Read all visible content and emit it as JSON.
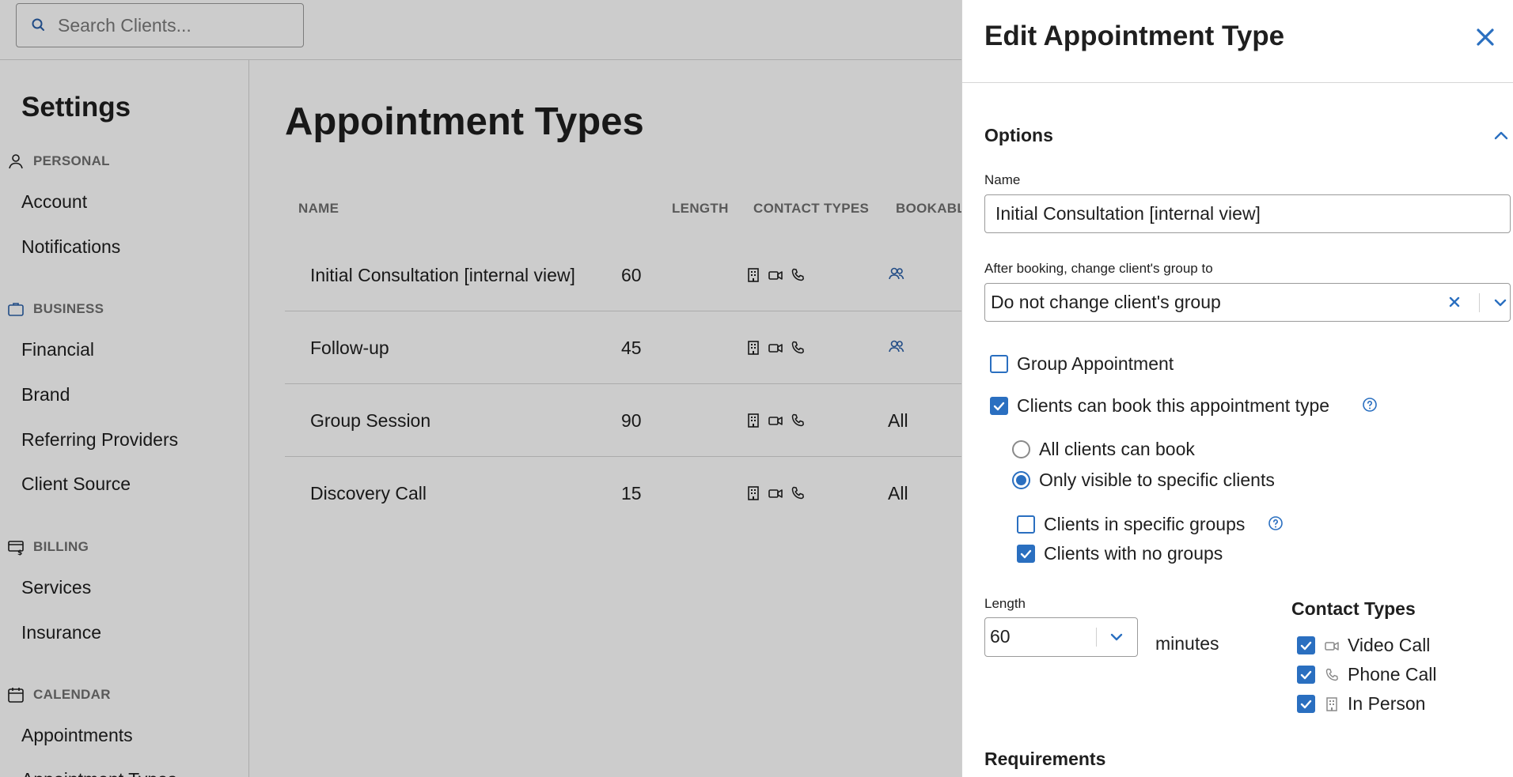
{
  "search": {
    "placeholder": "Search Clients..."
  },
  "sidebar": {
    "title": "Settings",
    "sections": [
      {
        "label": "PERSONAL",
        "icon": "person-icon",
        "items": [
          "Account",
          "Notifications"
        ]
      },
      {
        "label": "BUSINESS",
        "icon": "briefcase-icon",
        "items": [
          "Financial",
          "Brand",
          "Referring Providers",
          "Client Source"
        ]
      },
      {
        "label": "BILLING",
        "icon": "billing-icon",
        "items": [
          "Services",
          "Insurance"
        ]
      },
      {
        "label": "CALENDAR",
        "icon": "calendar-icon",
        "items": [
          "Appointments",
          "Appointment Types"
        ]
      }
    ]
  },
  "main": {
    "title": "Appointment Types",
    "columns": [
      "NAME",
      "LENGTH",
      "CONTACT TYPES",
      "BOOKABLE"
    ],
    "rows": [
      {
        "name": "Initial Consultation [internal view]",
        "length": "60",
        "contact_types": [
          "building-icon",
          "video-icon",
          "phone-icon"
        ],
        "bookable": "group-icon"
      },
      {
        "name": "Follow-up",
        "length": "45",
        "contact_types": [
          "building-icon",
          "video-icon",
          "phone-icon"
        ],
        "bookable": "group-icon"
      },
      {
        "name": "Group Session",
        "length": "90",
        "contact_types": [
          "building-icon",
          "video-icon",
          "phone-icon"
        ],
        "bookable": "All"
      },
      {
        "name": "Discovery Call",
        "length": "15",
        "contact_types": [
          "building-icon",
          "video-icon",
          "phone-icon"
        ],
        "bookable": "All"
      }
    ]
  },
  "panel": {
    "title": "Edit Appointment Type",
    "options_title": "Options",
    "name_label": "Name",
    "name_value": "Initial Consultation [internal view]",
    "group_label": "After booking, change client's group to",
    "group_value": "Do not change client's group",
    "group_appointment": {
      "label": "Group Appointment",
      "checked": false
    },
    "clients_can_book": {
      "label": "Clients can book this appointment type",
      "checked": true
    },
    "visibility": [
      {
        "label": "All clients can book",
        "selected": false
      },
      {
        "label": "Only visible to specific clients",
        "selected": true
      }
    ],
    "specific": [
      {
        "label": "Clients in specific groups",
        "checked": false
      },
      {
        "label": "Clients with no groups",
        "checked": true
      }
    ],
    "length_label": "Length",
    "length_value": "60",
    "length_unit": "minutes",
    "contact_types_title": "Contact Types",
    "contact_types": [
      {
        "label": "Video Call",
        "icon": "video-icon",
        "checked": true
      },
      {
        "label": "Phone Call",
        "icon": "phone-icon",
        "checked": true
      },
      {
        "label": "In Person",
        "icon": "building-icon",
        "checked": true
      }
    ],
    "requirements_title": "Requirements"
  },
  "colors": {
    "accent": "#2a6fc0",
    "muted_text": "#707070",
    "overlay": "rgba(0,0,0,0.2)"
  }
}
